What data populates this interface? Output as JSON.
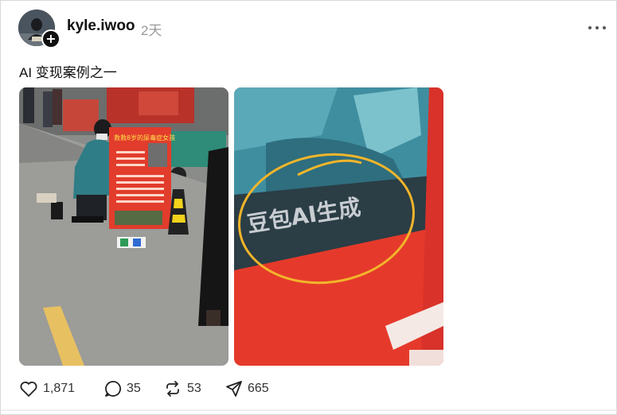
{
  "post": {
    "author": {
      "username": "kyle.iwoo",
      "avatar_icon": "user-avatar",
      "follow_badge": "+"
    },
    "timestamp": "2天",
    "more_icon": "more-horizontal-icon",
    "text": "AI 变现案例之一",
    "images": [
      {
        "id_label": "street-photo",
        "sign_title": "救救8岁的尿毒症女孩"
      },
      {
        "id_label": "closeup-photo",
        "watermark_text": "豆包AI生成"
      }
    ],
    "stats": {
      "likes": "1,871",
      "replies": "35",
      "reposts": "53",
      "shares": "665"
    }
  },
  "colors": {
    "accent_red": "#e53a2b",
    "teal": "#3f8ea0",
    "circle_yellow": "#f2b52a",
    "muted_text": "#999999"
  }
}
